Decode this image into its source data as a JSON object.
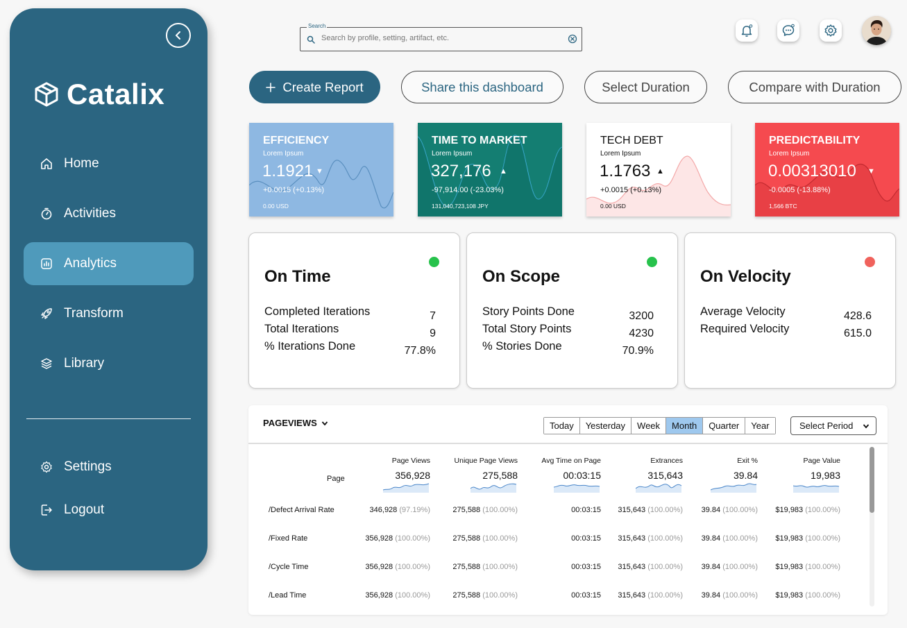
{
  "app": {
    "brand": "Catalix"
  },
  "sidebar": {
    "items": [
      {
        "label": "Home",
        "icon": "home-icon"
      },
      {
        "label": "Activities",
        "icon": "stopwatch-icon"
      },
      {
        "label": "Analytics",
        "icon": "chart-icon",
        "active": true
      },
      {
        "label": "Transform",
        "icon": "rocket-icon"
      },
      {
        "label": "Library",
        "icon": "layers-icon"
      }
    ],
    "bottom": [
      {
        "label": "Settings",
        "icon": "gear-icon"
      },
      {
        "label": "Logout",
        "icon": "logout-icon"
      }
    ]
  },
  "search": {
    "legend": "Search",
    "placeholder": "Search by profile, setting, artifact, etc."
  },
  "actions": {
    "create": "Create Report",
    "share": "Share this dashboard",
    "duration": "Select Duration",
    "compare": "Compare with Duration"
  },
  "kpis": [
    {
      "title": "EFFICIENCY",
      "sub": "Lorem Ipsum",
      "value": "1.1921",
      "trend": "down",
      "change": "+0.0015 (+0.13%)",
      "base": "0.00 USD",
      "color": "#8eb8e2"
    },
    {
      "title": "TIME TO MARKET",
      "sub": "Lorem Ipsum",
      "value": "327,176",
      "trend": "up",
      "change": "-97,914.00 (-23.03%)",
      "base": "131,040,723,108 JPY",
      "color": "#147e72"
    },
    {
      "title": "TECH DEBT",
      "sub": "Lorem Ipsum",
      "value": "1.1763",
      "trend": "up",
      "change": "+0.0015 (+0.13%)",
      "base": "0.00 USD",
      "color": "#ffffff"
    },
    {
      "title": "PREDICTABILITY",
      "sub": "Lorem Ipsum",
      "value": "0.00313010",
      "trend": "down",
      "change": "-0.0005 (-13.88%)",
      "base": "1,566 BTC",
      "color": "#f54a4f"
    }
  ],
  "status": [
    {
      "title": "On Time",
      "dot": "#27c24c",
      "labels": [
        "Completed Iterations",
        "Total Iterations",
        "% Iterations Done"
      ],
      "values": [
        "7",
        "9",
        "77.8%"
      ]
    },
    {
      "title": "On Scope",
      "dot": "#27c24c",
      "labels": [
        "Story Points Done",
        "Total Story Points",
        "% Stories Done"
      ],
      "values": [
        "3200",
        "4230",
        "70.9%"
      ]
    },
    {
      "title": "On Velocity",
      "dot": "#f0625c",
      "labels": [
        "Average Velocity",
        "Required Velocity"
      ],
      "values": [
        "428.6",
        "615.0"
      ]
    }
  ],
  "pageviews": {
    "title": "PAGEVIEWS",
    "ranges": [
      "Today",
      "Yesterday",
      "Week",
      "Month",
      "Quarter",
      "Year"
    ],
    "selected_range": "Month",
    "period_select": "Select Period",
    "page_header": "Page",
    "columns": [
      {
        "label": "Page Views",
        "total": "356,928"
      },
      {
        "label": "Unique Page Views",
        "total": "275,588"
      },
      {
        "label": "Avg Time on Page",
        "total": "00:03:15"
      },
      {
        "label": "Extrances",
        "total": "315,643"
      },
      {
        "label": "Exit %",
        "total": "39.84"
      },
      {
        "label": "Page Value",
        "total": "19,983"
      }
    ],
    "rows": [
      {
        "page": "/Defect Arrival Rate",
        "cells": [
          [
            "346,928",
            "(97.19%)"
          ],
          [
            "275,588",
            "(100.00%)"
          ],
          [
            "00:03:15",
            ""
          ],
          [
            "315,643",
            "(100.00%)"
          ],
          [
            "39.84",
            "(100.00%)"
          ],
          [
            "$19,983",
            "(100.00%)"
          ]
        ]
      },
      {
        "page": "/Fixed Rate",
        "cells": [
          [
            "356,928",
            "(100.00%)"
          ],
          [
            "275,588",
            "(100.00%)"
          ],
          [
            "00:03:15",
            ""
          ],
          [
            "315,643",
            "(100.00%)"
          ],
          [
            "39.84",
            "(100.00%)"
          ],
          [
            "$19,983",
            "(100.00%)"
          ]
        ]
      },
      {
        "page": "/Cycle Time",
        "cells": [
          [
            "356,928",
            "(100.00%)"
          ],
          [
            "275,588",
            "(100.00%)"
          ],
          [
            "00:03:15",
            ""
          ],
          [
            "315,643",
            "(100.00%)"
          ],
          [
            "39.84",
            "(100.00%)"
          ],
          [
            "$19,983",
            "(100.00%)"
          ]
        ]
      },
      {
        "page": "/Lead Time",
        "cells": [
          [
            "356,928",
            "(100.00%)"
          ],
          [
            "275,588",
            "(100.00%)"
          ],
          [
            "00:03:15",
            ""
          ],
          [
            "315,643",
            "(100.00%)"
          ],
          [
            "39.84",
            "(100.00%)"
          ],
          [
            "$19,983",
            "(100.00%)"
          ]
        ]
      }
    ]
  },
  "colors": {
    "sidebar": "#2b6581",
    "sidebar_active": "#4f9abb",
    "accent": "#2b6581"
  }
}
